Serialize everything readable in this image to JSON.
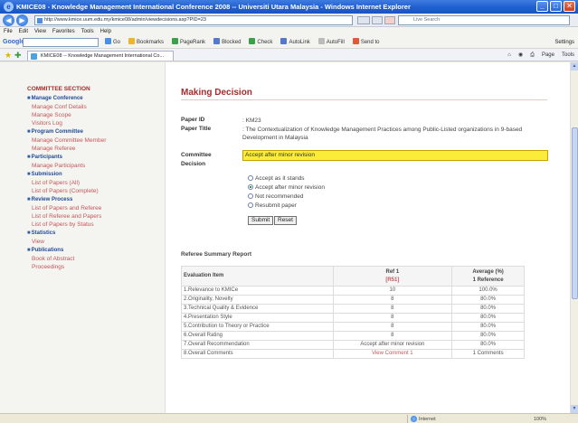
{
  "window": {
    "title": "KMICE08 - Knowledge Management International Conference 2008 -- Universiti Utara Malaysia - Windows Internet Explorer",
    "min_label": "_",
    "max_label": "□",
    "close_label": "✕"
  },
  "address": {
    "url": "http://www.kmice.uum.edu.my/kmice08/admin/viewdecisions.asp?PID=23",
    "search_placeholder": "Live Search",
    "back_label": "◀",
    "fwd_label": "▶"
  },
  "menu": [
    "File",
    "Edit",
    "View",
    "Favorites",
    "Tools",
    "Help"
  ],
  "google_toolbar": {
    "logo": "Google",
    "items": [
      "Go",
      "Bookmarks",
      "PageRank",
      "Blocked",
      "Check",
      "AutoLink",
      "AutoFill",
      "Send to"
    ],
    "settings": "Settings"
  },
  "tabbar": {
    "tab_title": "KMICE08 -- Knowledge Management International Co...",
    "commands": [
      "Page",
      "Tools"
    ]
  },
  "sidebar": {
    "heading": "COMMITTEE SECTION",
    "groups": [
      {
        "title": "Manage Conference",
        "links": [
          "Manage Conf Details",
          "Manage Scope",
          "Visitors Log"
        ]
      },
      {
        "title": "Program Committee",
        "links": [
          "Manage Committee Member",
          "Manage Referee"
        ]
      },
      {
        "title": "Participants",
        "links": [
          "Manage Participants"
        ]
      },
      {
        "title": "Submission",
        "links": [
          "List of Papers (All)",
          "List of Papers (Complete)"
        ]
      },
      {
        "title": "Review Process",
        "links": [
          "List of Papers and Referee",
          "List of Referee and Papers",
          "List of Papers by Status"
        ]
      },
      {
        "title": "Statistics",
        "links": [
          "View"
        ]
      },
      {
        "title": "Publications",
        "links": [
          "Book of Abstract",
          "Proceedings"
        ]
      }
    ]
  },
  "main": {
    "title": "Making Decision",
    "paper_id_label": "Paper ID",
    "paper_id_value": ": KM23",
    "paper_title_label": "Paper Title",
    "paper_title_value": ": The Contextualization of Knowledge Management Practices among Public-Listed organizations in 9-based Development in Malaysia",
    "decision_label_1": "Committee",
    "decision_label_2": "Decision",
    "decision_value": "Accept after minor revision",
    "options": [
      "Accept as it stands",
      "Accept after minor revision",
      "Not recommended",
      "Resubmit paper"
    ],
    "selected_index": 1,
    "submit_label": "Submit",
    "reset_label": "Reset",
    "report_heading": "Referee Summary Report",
    "table": {
      "col_item": "Evaluation Item",
      "col_ref_1": "Ref 1",
      "col_ref_2": "[R51]",
      "col_avg_1": "Average (%)",
      "col_avg_2": "1 Reference",
      "rows": [
        {
          "item": "1.Relevance to KMICe",
          "ref": "10",
          "avg": "100.0%"
        },
        {
          "item": "2.Originality, Novelty",
          "ref": "8",
          "avg": "80.0%"
        },
        {
          "item": "3.Technical Quality & Evidence",
          "ref": "8",
          "avg": "80.0%"
        },
        {
          "item": "4.Presentation Style",
          "ref": "8",
          "avg": "80.0%"
        },
        {
          "item": "5.Contribution to Theory or Practice",
          "ref": "8",
          "avg": "80.0%"
        },
        {
          "item": "6.Overall Rating",
          "ref": "8",
          "avg": "80.0%"
        },
        {
          "item": "7.Overall Recommendation",
          "ref": "Accept after minor revision",
          "avg": "80.0%"
        },
        {
          "item": "8.Overall Comments",
          "ref": "View Comment 1",
          "avg": "1 Comments"
        }
      ]
    }
  },
  "status": {
    "zone": "Internet",
    "zoom": "100%"
  }
}
